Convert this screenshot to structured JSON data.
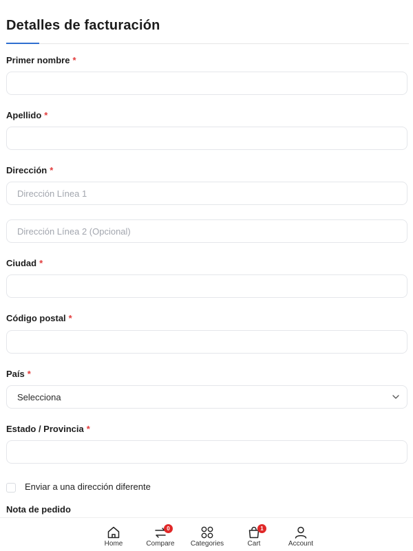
{
  "form": {
    "title": "Detalles de facturación",
    "required_mark": "*",
    "first_name": {
      "label": "Primer nombre"
    },
    "last_name": {
      "label": "Apellido"
    },
    "address": {
      "label": "Dirección",
      "line1_placeholder": "Dirección Línea 1",
      "line2_placeholder": "Dirección Línea 2 (Opcional)"
    },
    "city": {
      "label": "Ciudad"
    },
    "postal_code": {
      "label": "Código postal"
    },
    "country": {
      "label": "País",
      "selected": "Selecciona"
    },
    "state": {
      "label": "Estado / Provincia"
    },
    "ship_different": {
      "label": "Enviar a una dirección diferente",
      "checked": false
    },
    "order_notes": {
      "label": "Nota de pedido"
    }
  },
  "bottom_nav": {
    "items": [
      {
        "label": "Home",
        "icon": "home-icon"
      },
      {
        "label": "Compare",
        "icon": "compare-icon",
        "badge": "0"
      },
      {
        "label": "Categories",
        "icon": "categories-icon"
      },
      {
        "label": "Cart",
        "icon": "cart-icon",
        "badge": "1"
      },
      {
        "label": "Account",
        "icon": "account-icon"
      }
    ]
  },
  "colors": {
    "accent": "#2f6fd0",
    "required": "#e23b3b",
    "badge": "#e02828"
  }
}
